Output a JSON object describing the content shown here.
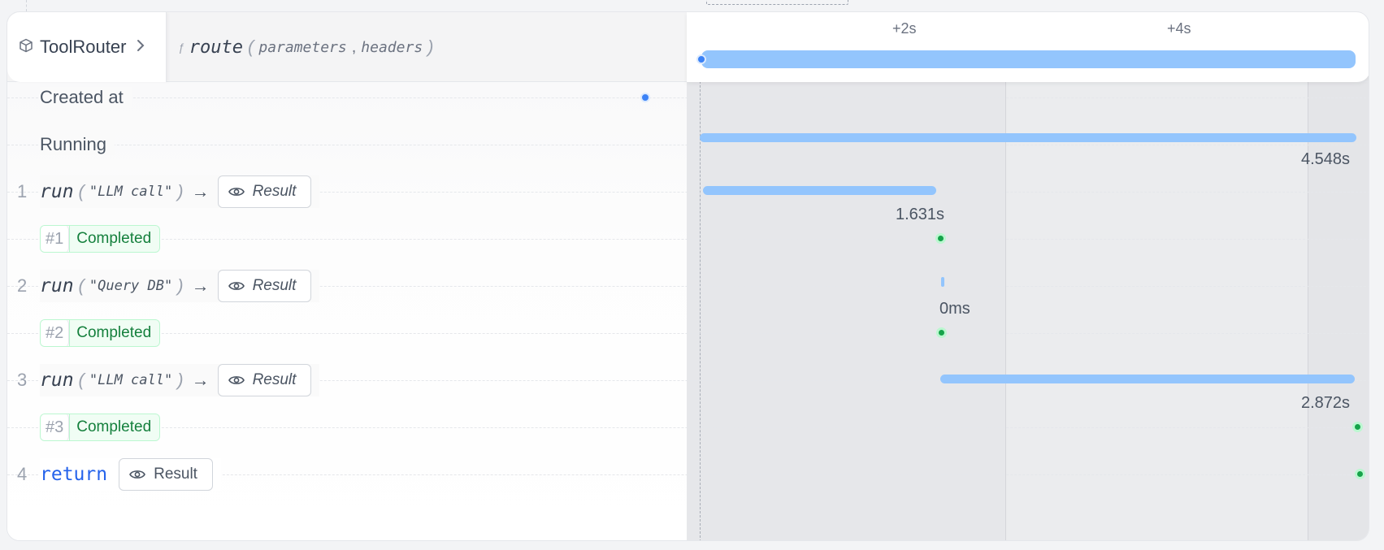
{
  "header": {
    "breadcrumb": "ToolRouter",
    "function_name": "route",
    "params": [
      "parameters",
      "headers"
    ],
    "ticks": [
      "+2s",
      "+4s"
    ]
  },
  "rows": {
    "created_label": "Created at",
    "running_label": "Running",
    "running_duration": "4.548s",
    "step1": {
      "num": "1",
      "kw": "run",
      "arg": "\"LLM call\"",
      "result": "Result",
      "duration": "1.631s",
      "status_idx": "#1",
      "status": "Completed"
    },
    "step2": {
      "num": "2",
      "kw": "run",
      "arg": "\"Query DB\"",
      "result": "Result",
      "duration": "0ms",
      "status_idx": "#2",
      "status": "Completed"
    },
    "step3": {
      "num": "3",
      "kw": "run",
      "arg": "\"LLM call\"",
      "result": "Result",
      "duration": "2.872s",
      "status_idx": "#3",
      "status": "Completed"
    },
    "step4": {
      "num": "4",
      "kw": "return",
      "result": "Result"
    }
  },
  "colors": {
    "bar": "#93c5fd",
    "start_dot": "#3b82f6",
    "complete_dot": "#16a34a",
    "status_text": "#15803d",
    "return_kw": "#2563eb"
  },
  "icons": [
    "cube-icon",
    "chevron-right-icon",
    "function-icon",
    "arrow-right-icon",
    "eye-icon"
  ]
}
